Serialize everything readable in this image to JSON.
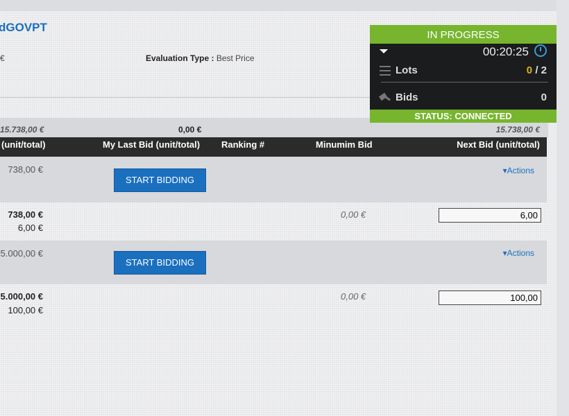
{
  "header": {
    "title": "dGOVPT",
    "currency_fragment": "€",
    "evaluation_label": "Evaluation Type :",
    "evaluation_value": "Best Price"
  },
  "summary": {
    "total": "15.738,00 €",
    "my_last_bid_total": "0,00 €",
    "next_bid_total": "15.738,00 €"
  },
  "table": {
    "columns": [
      "(unit/total)",
      "My Last Bid (unit/total)",
      "Ranking #",
      "Minumim Bid",
      "Next Bid (unit/total)"
    ],
    "lots": [
      {
        "price_partial": "738,00 €",
        "start_label": "START BIDDING",
        "actions_label": "Actions",
        "detail_total": "738,00 €",
        "detail_unit": "6,00 €",
        "min_bid": "0,00 €",
        "next_bid_value": "6,00"
      },
      {
        "price_partial": "5.000,00 €",
        "start_label": "START BIDDING",
        "actions_label": "Actions",
        "detail_total": "5.000,00 €",
        "detail_unit": "100,00 €",
        "min_bid": "0,00 €",
        "next_bid_value": "100,00"
      }
    ]
  },
  "panel": {
    "state": "IN PROGRESS",
    "timer": "00:20:25",
    "lots_label": "Lots",
    "lots_done": "0",
    "lots_total": "/ 2",
    "bids_label": "Bids",
    "bids_count": "0",
    "status": "STATUS: CONNECTED",
    "colors": {
      "accent": "#77b52e",
      "dark": "#1b1c1d",
      "highlight": "#e0b020",
      "link": "#1a6fbf"
    },
    "icons": [
      "chevron-down-icon",
      "stopwatch-icon",
      "list-icon",
      "gavel-icon"
    ]
  }
}
